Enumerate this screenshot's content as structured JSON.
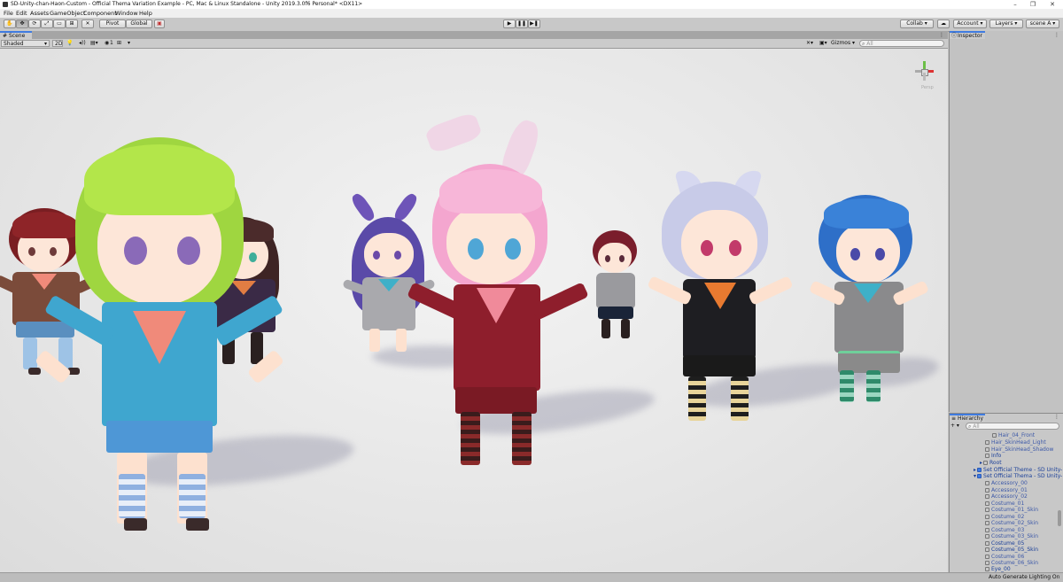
{
  "window": {
    "title": "SD-Unity-chan-Haon-Custom - Official Thema Variation Example - PC, Mac & Linux Standalone - Unity 2019.3.0f6 Personal* <DX11>",
    "minimize": "–",
    "maximize": "❐",
    "close": "✕"
  },
  "menu": [
    "File",
    "Edit",
    "Assets",
    "GameObject",
    "Component",
    "Window",
    "Help"
  ],
  "toolbar": {
    "pivot": "Pivot",
    "global": "Global",
    "collab": "Collab ▾",
    "account": "Account ▾",
    "layers": "Layers ▾",
    "layout": "scene A ▾"
  },
  "scene": {
    "tab_label": "Scene",
    "shading_mode": "Shaded",
    "mode_2d": "2D",
    "fx_count": "1",
    "gizmos_label": "Gizmos",
    "search_placeholder": "All",
    "persp_label": "Persp"
  },
  "inspector": {
    "tab_label": "Inspector"
  },
  "hierarchy": {
    "tab_label": "Hierarchy",
    "add_label": "+ ▾",
    "search_placeholder": "All",
    "rows": [
      "Hair_04_Front",
      "Hair_SkinHead_Light",
      "Hair_SkinHead_Shadow",
      "Info",
      "Root",
      "Set Official Theme - SD Unity-",
      "Set Official Thema - SD Unity-",
      "Accessory_00",
      "Accessory_01",
      "Accessory_02",
      "Costume_01",
      "Costume_01_Skin",
      "Costume_02",
      "Costume_02_Skin",
      "Costume_03",
      "Costume_03_Skin",
      "Costume_05",
      "Costume_05_Skin",
      "Costume_06",
      "Costume_06_Skin",
      "Eye_00"
    ]
  },
  "status": {
    "text": "Auto Generate Lighting On"
  },
  "colors": {
    "accent": "#3f7be0",
    "editor_bg": "#c2c2c2",
    "hierarchy_text": "#3d59a8"
  }
}
